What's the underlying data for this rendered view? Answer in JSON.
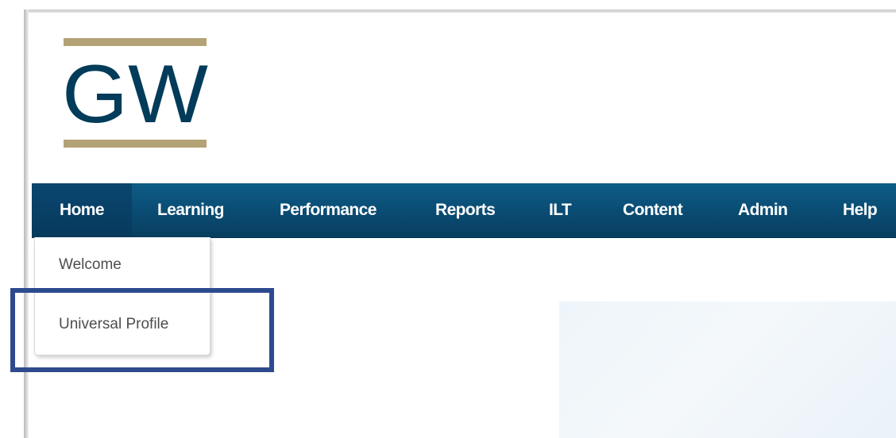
{
  "logo": {
    "text": "GW",
    "bar_color": "#b3a276",
    "text_color": "#033c5a"
  },
  "nav": {
    "items": [
      {
        "label": "Home"
      },
      {
        "label": "Learning"
      },
      {
        "label": "Performance"
      },
      {
        "label": "Reports"
      },
      {
        "label": "ILT"
      },
      {
        "label": "Content"
      },
      {
        "label": "Admin"
      },
      {
        "label": "Help"
      }
    ],
    "background_color": "#0a4b72"
  },
  "home_menu": {
    "items": [
      {
        "label": "Welcome"
      },
      {
        "label": "Universal Profile"
      }
    ],
    "highlighted_item": "Universal Profile",
    "highlight_color": "#2e4a8f"
  }
}
